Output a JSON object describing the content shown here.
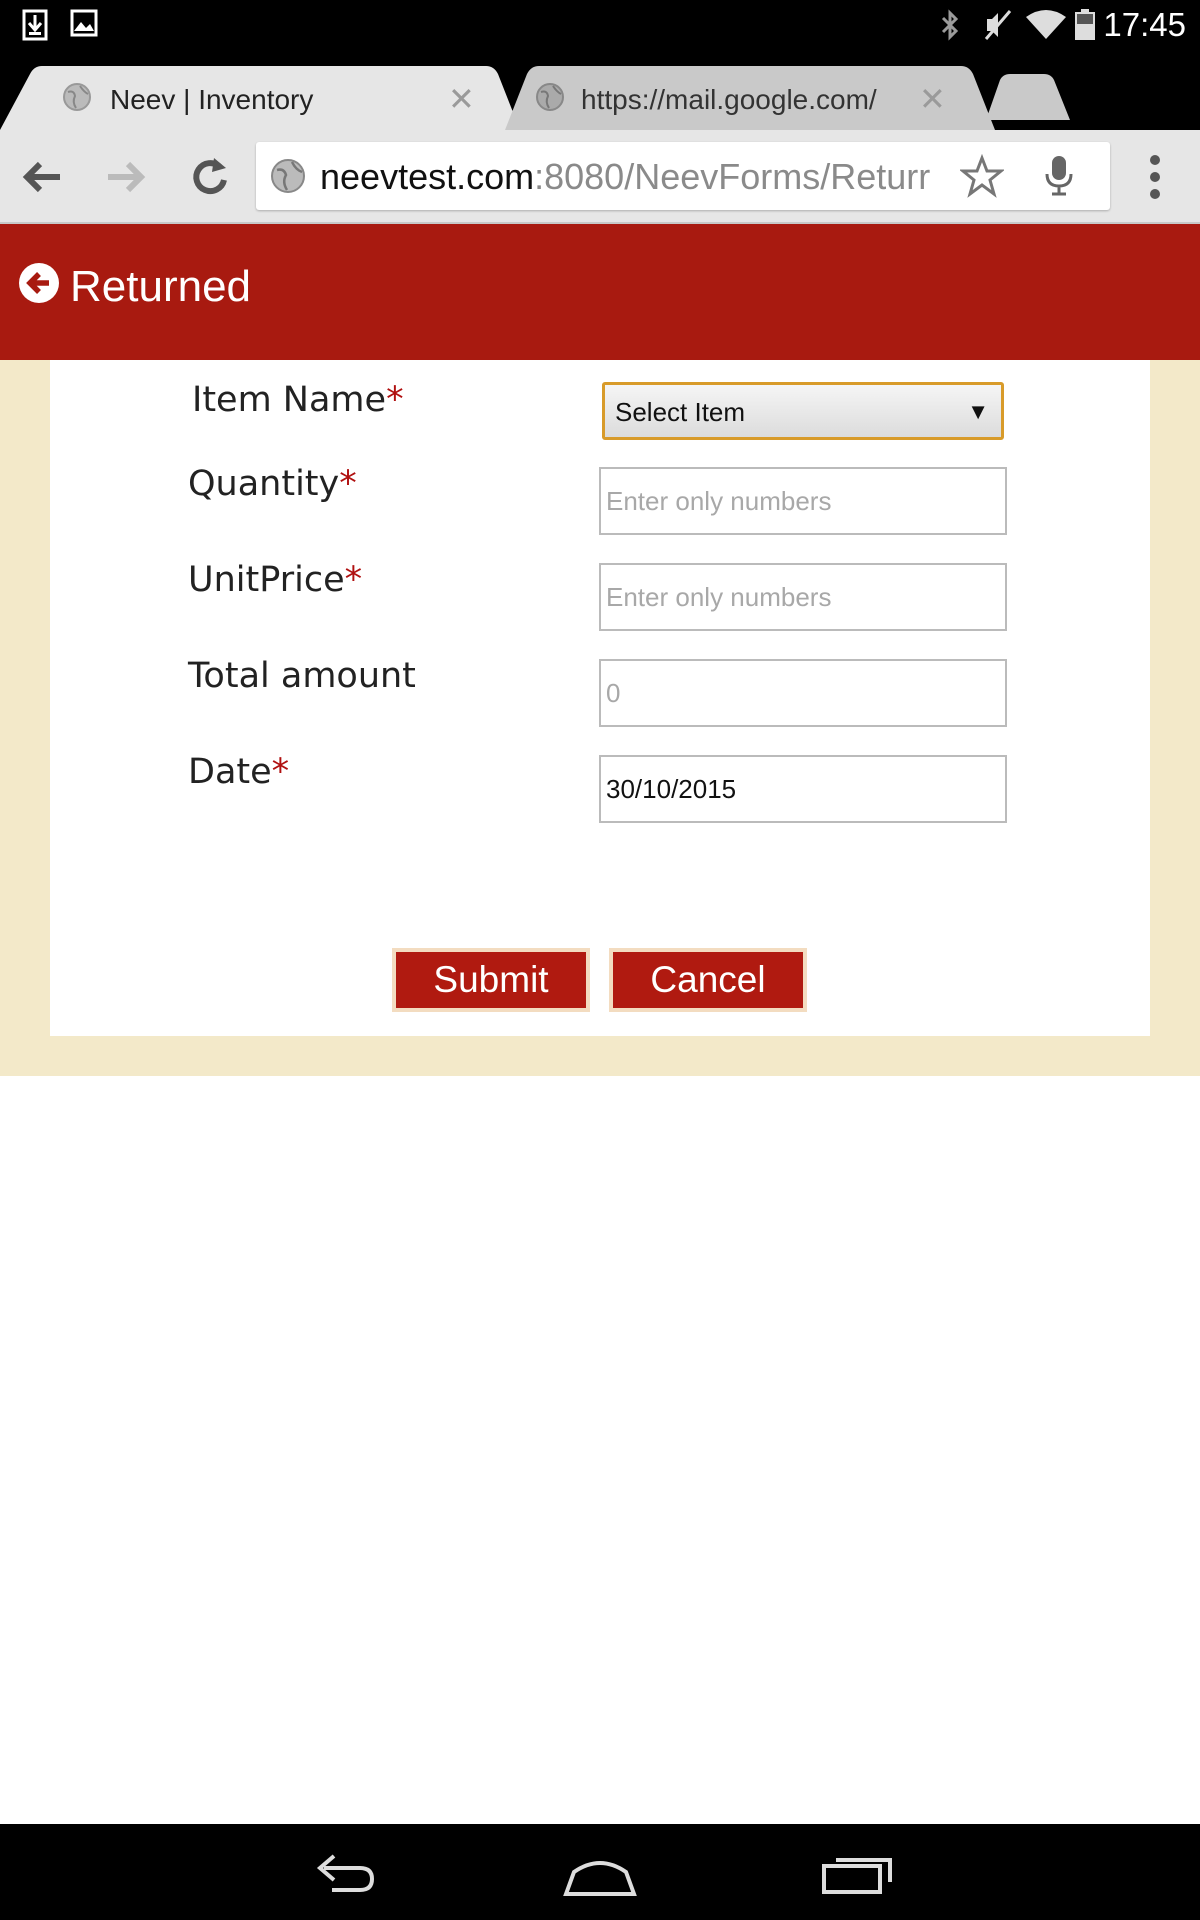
{
  "status_bar": {
    "time": "17:45",
    "left_icons": [
      "download-icon",
      "image-icon"
    ],
    "right_icons": [
      "bluetooth-icon",
      "mute-icon",
      "wifi-icon",
      "battery-icon"
    ]
  },
  "browser": {
    "tabs": [
      {
        "title": "Neev | Inventory",
        "active": true
      },
      {
        "title": "https://mail.google.com/",
        "active": false
      }
    ],
    "url_host": "neevtest.com",
    "url_path": ":8080/NeevForms/Returr"
  },
  "page": {
    "title": "Returned",
    "colors": {
      "header": "#a81a10",
      "background": "#f3e9c9",
      "focus": "#d89b2a"
    }
  },
  "form": {
    "item_name_label": "Item Name",
    "item_select_value": "Select Item",
    "quantity_label": "Quantity",
    "quantity_placeholder": "Enter only numbers",
    "unit_price_label": "UnitPrice",
    "unit_price_placeholder": "Enter only numbers",
    "total_label": "Total amount",
    "total_placeholder": "0",
    "date_label": "Date",
    "date_value": "30/10/2015",
    "required_mark": "*",
    "submit_label": "Submit",
    "cancel_label": "Cancel"
  }
}
